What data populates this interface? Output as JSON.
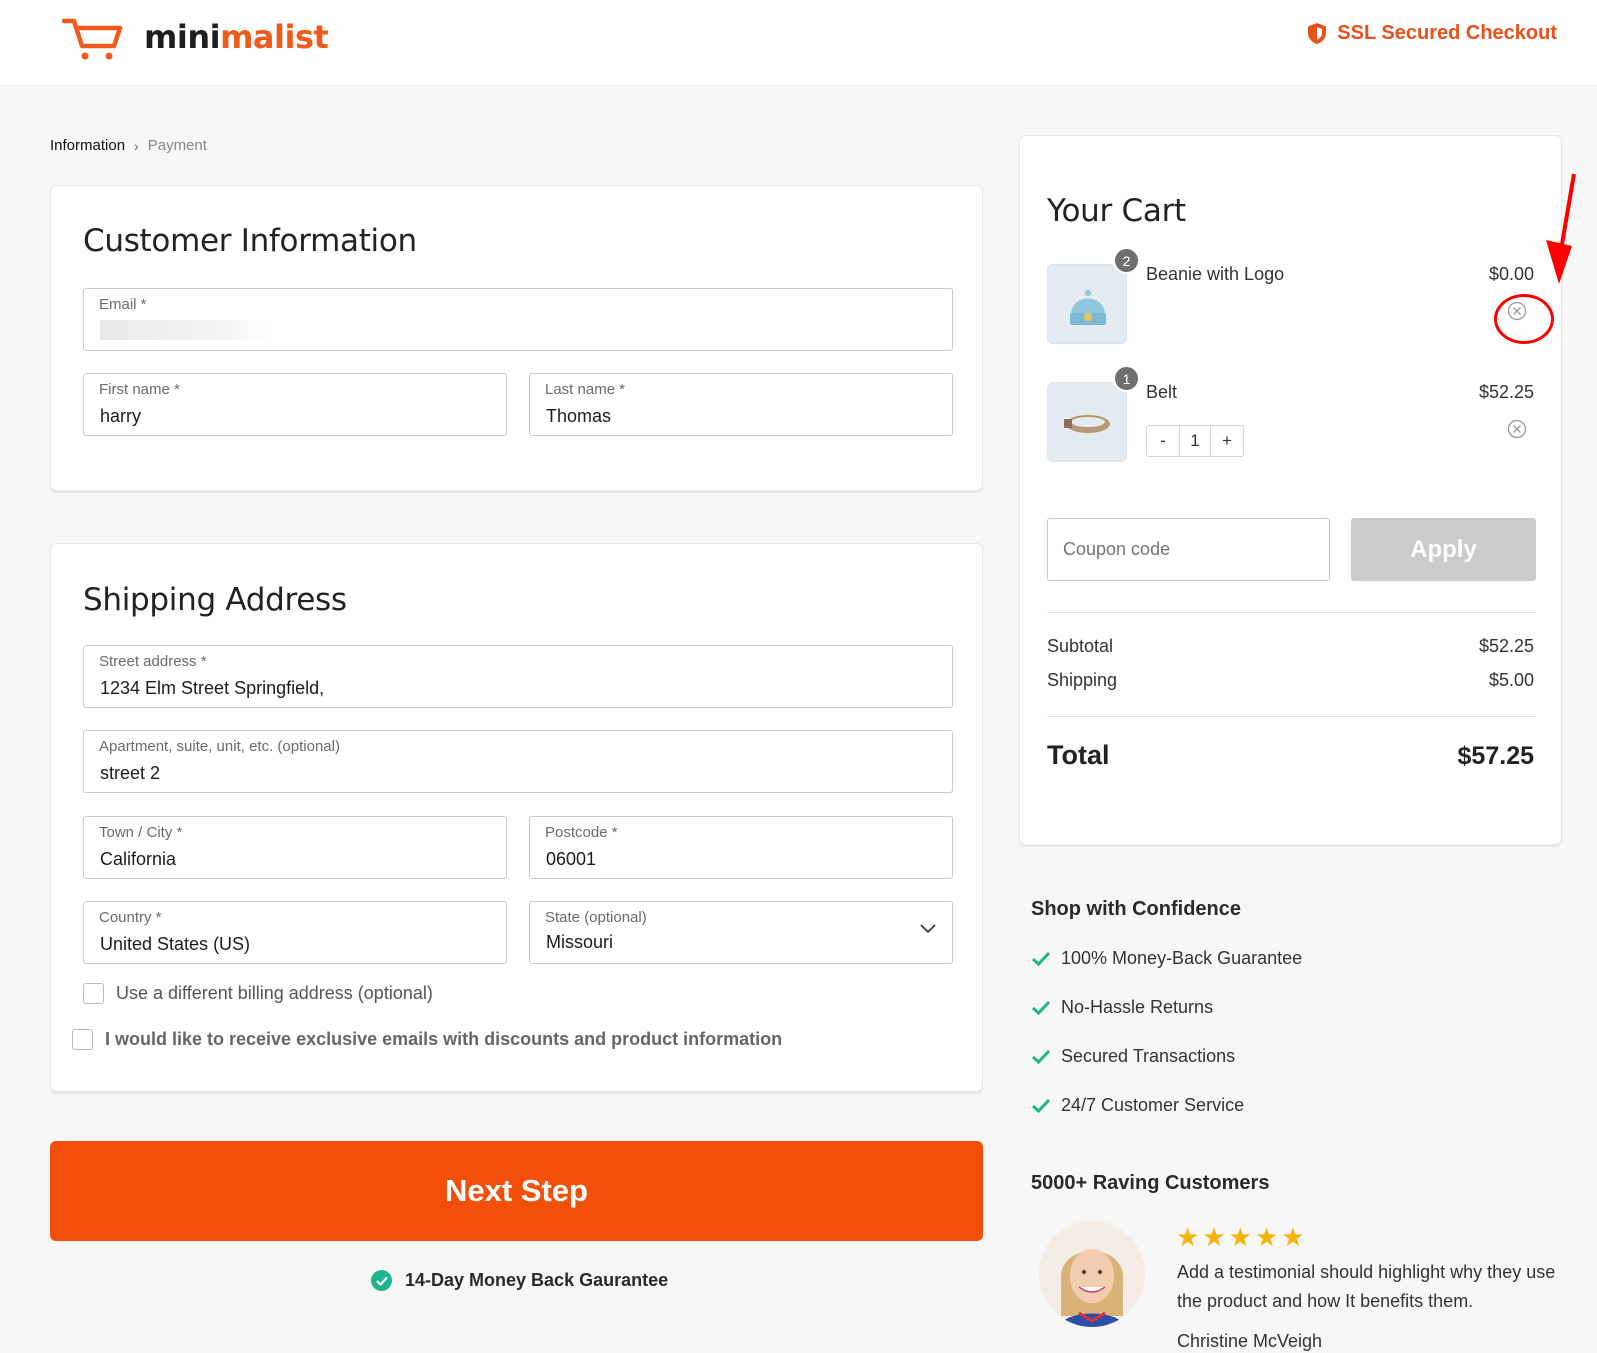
{
  "header": {
    "brand_a": "mini",
    "brand_b": "malist",
    "ssl_label": "SSL Secured Checkout",
    "accent_color": "#f05a1a"
  },
  "breadcrumb": {
    "current": "Information",
    "next": "Payment"
  },
  "customer": {
    "title": "Customer Information",
    "email_label": "Email *",
    "email_value": "",
    "first_name_label": "First name *",
    "first_name_value": "harry",
    "last_name_label": "Last name *",
    "last_name_value": "Thomas"
  },
  "shipping": {
    "title": "Shipping Address",
    "street_label": "Street address *",
    "street_value": "1234 Elm Street Springfield,",
    "apt_label": "Apartment, suite, unit, etc. (optional)",
    "apt_value": "street 2",
    "city_label": "Town / City *",
    "city_value": "California",
    "postcode_label": "Postcode *",
    "postcode_value": "06001",
    "country_label": "Country *",
    "country_value": "United States (US)",
    "state_label": "State (optional)",
    "state_value": "Missouri",
    "billing_checkbox": "Use a different billing address (optional)",
    "emails_checkbox": "I would like to receive exclusive emails with discounts and product information"
  },
  "actions": {
    "next_step": "Next Step",
    "guarantee": "14-Day Money Back Gaurantee"
  },
  "cart": {
    "title": "Your Cart",
    "items": [
      {
        "name": "Beanie with Logo",
        "price": "$0.00",
        "badge": "2",
        "icon": "beanie-image"
      },
      {
        "name": "Belt",
        "price": "$52.25",
        "badge": "1",
        "quantity": "1",
        "icon": "belt-image"
      }
    ],
    "stepper_minus": "-",
    "stepper_plus": "+",
    "coupon_placeholder": "Coupon code",
    "apply_label": "Apply",
    "subtotal_label": "Subtotal",
    "subtotal_value": "$52.25",
    "shipping_label": "Shipping",
    "shipping_value": "$5.00",
    "total_label": "Total",
    "total_value": "$57.25"
  },
  "confidence": {
    "title": "Shop with Confidence",
    "items": [
      "100% Money-Back Guarantee",
      "No-Hassle Returns",
      "Secured Transactions",
      "24/7 Customer Service"
    ],
    "check_color": "#1fb58a"
  },
  "testimonial": {
    "title": "5000+ Raving Customers",
    "rating": 5,
    "text": "Add a testimonial should highlight why they use the product and how It benefits them.",
    "name": "Christine McVeigh"
  }
}
